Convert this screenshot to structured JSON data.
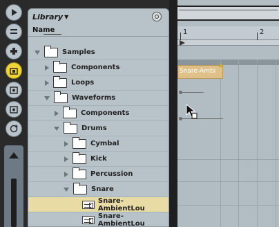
{
  "browser": {
    "title": "Library",
    "column_header": "Name",
    "items": [
      {
        "label": "Samples",
        "kind": "folder",
        "expanded": true,
        "depth": 0
      },
      {
        "label": "Components",
        "kind": "folder",
        "expanded": false,
        "depth": 1
      },
      {
        "label": "Loops",
        "kind": "folder",
        "expanded": false,
        "depth": 1
      },
      {
        "label": "Waveforms",
        "kind": "folder",
        "expanded": true,
        "depth": 1
      },
      {
        "label": "Components",
        "kind": "folder",
        "expanded": false,
        "depth": 2
      },
      {
        "label": "Drums",
        "kind": "folder",
        "expanded": true,
        "depth": 2
      },
      {
        "label": "Cymbal",
        "kind": "folder",
        "expanded": false,
        "depth": 3
      },
      {
        "label": "Kick",
        "kind": "folder",
        "expanded": false,
        "depth": 3
      },
      {
        "label": "Percussion",
        "kind": "folder",
        "expanded": false,
        "depth": 3
      },
      {
        "label": "Snare",
        "kind": "folder",
        "expanded": true,
        "depth": 3
      },
      {
        "label": "Snare-AmbientLou",
        "kind": "file",
        "selected": true,
        "depth": 4
      },
      {
        "label": "Snare-AmbientLou",
        "kind": "file",
        "selected": false,
        "depth": 4
      }
    ]
  },
  "arrangement": {
    "ruler_labels": [
      "1",
      "2"
    ],
    "clip_name": "Snare-Ambi"
  },
  "colors": {
    "browser_bg": "#b8c2c9",
    "selected_row": "#e9dba4",
    "clip": "#dfc088",
    "active_rail_button": "#f0d437"
  }
}
